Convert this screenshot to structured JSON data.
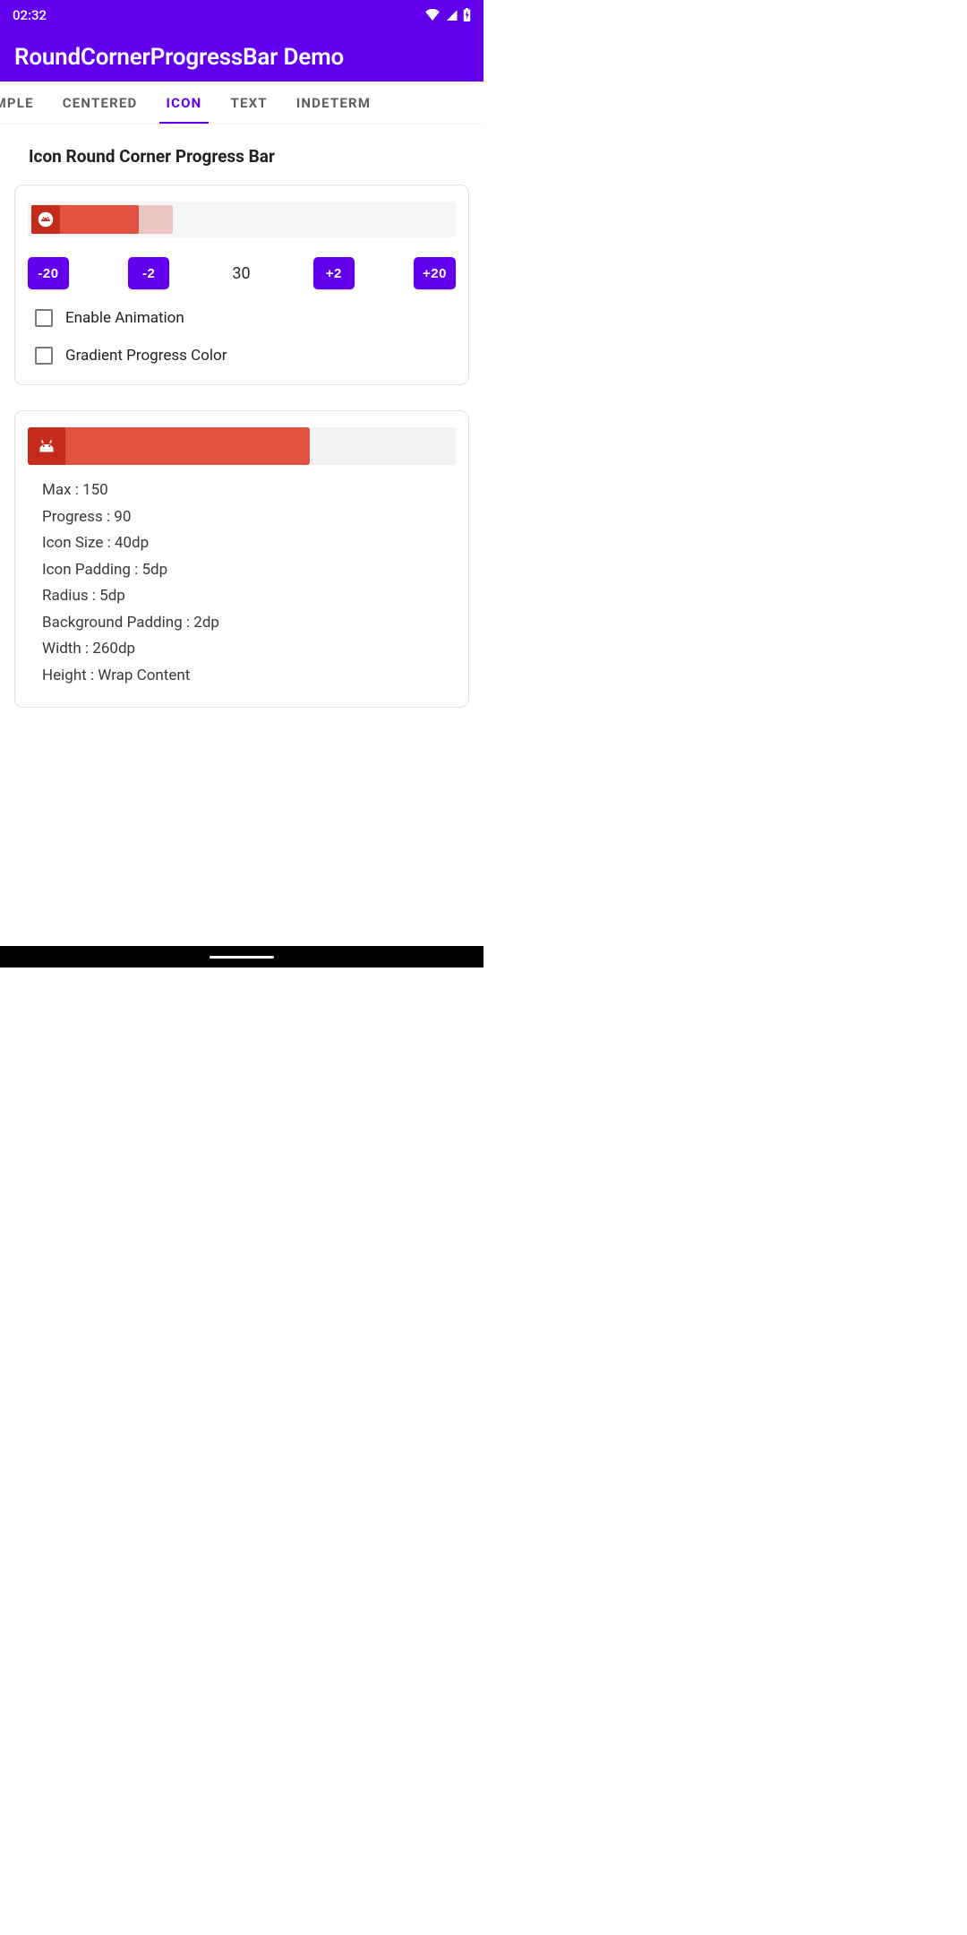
{
  "status": {
    "time": "02:32"
  },
  "app": {
    "title": "RoundCornerProgressBar Demo"
  },
  "tabs": {
    "items": [
      "IMPLE",
      "CENTERED",
      "ICON",
      "TEXT",
      "INDETERM"
    ],
    "active_index": 2
  },
  "section": {
    "title": "Icon Round Corner Progress Bar"
  },
  "card1": {
    "progress": {
      "max": 100,
      "value": 30,
      "secondary": 40
    },
    "buttons": {
      "dec20": "-20",
      "dec2": "-2",
      "inc2": "+2",
      "inc20": "+20"
    },
    "value_text": "30",
    "check_anim": "Enable Animation",
    "check_grad": "Gradient Progress Color"
  },
  "card2": {
    "progress": {
      "max": 150,
      "value": 90
    },
    "specs": [
      "Max : 150",
      "Progress : 90",
      "Icon Size : 40dp",
      "Icon Padding : 5dp",
      "Radius : 5dp",
      "Background Padding : 2dp",
      "Width : 260dp",
      "Height : Wrap Content"
    ]
  }
}
